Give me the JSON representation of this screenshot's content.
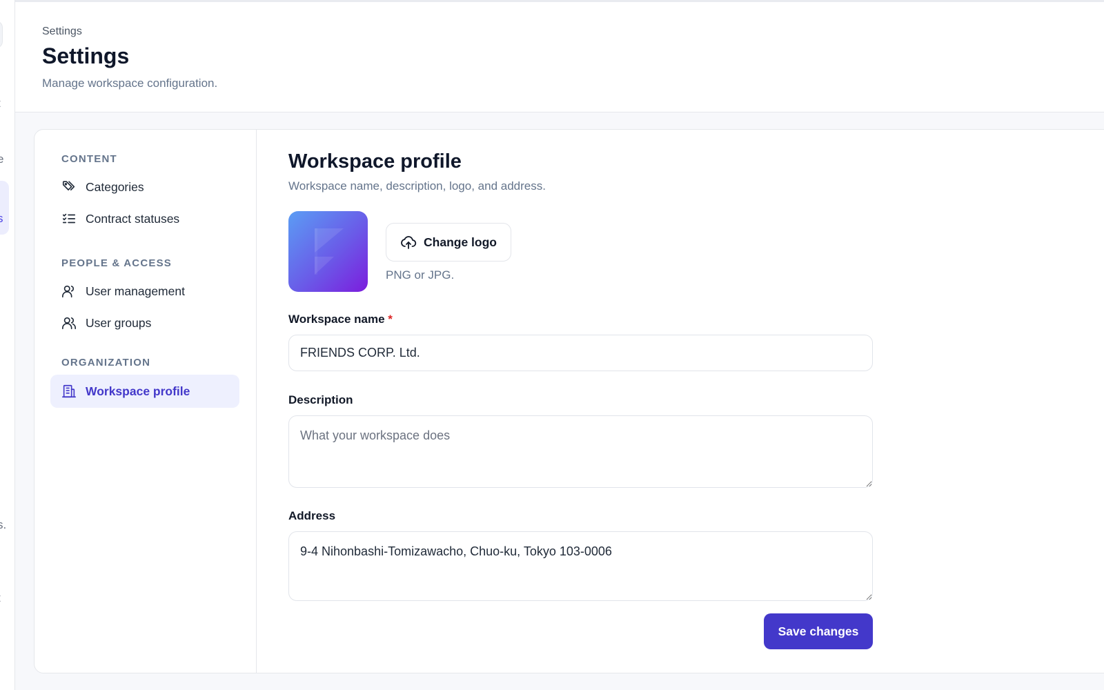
{
  "rail": {
    "fragments": [
      "t",
      "e",
      "s",
      "s.",
      "t"
    ]
  },
  "header": {
    "breadcrumb": "Settings",
    "title": "Settings",
    "subtitle": "Manage workspace configuration."
  },
  "subnav": {
    "sections": [
      {
        "label": "CONTENT",
        "items": [
          {
            "label": "Categories",
            "icon": "tags-icon"
          },
          {
            "label": "Contract statuses",
            "icon": "list-checks-icon"
          }
        ]
      },
      {
        "label": "PEOPLE & ACCESS",
        "items": [
          {
            "label": "User management",
            "icon": "user-icon"
          },
          {
            "label": "User groups",
            "icon": "users-icon"
          }
        ]
      },
      {
        "label": "ORGANIZATION",
        "items": [
          {
            "label": "Workspace profile",
            "icon": "building-icon",
            "active": true
          }
        ]
      }
    ]
  },
  "content": {
    "title": "Workspace profile",
    "subtitle": "Workspace name, description, logo, and address.",
    "logo": {
      "change_button": "Change logo",
      "button_icon": "cloud-upload-icon",
      "hint": "PNG or JPG."
    },
    "fields": {
      "workspace_name": {
        "label": "Workspace name",
        "required_mark": "*",
        "value": "FRIENDS CORP. Ltd."
      },
      "description": {
        "label": "Description",
        "value": "",
        "placeholder": "What your workspace does"
      },
      "address": {
        "label": "Address",
        "value": "9-4 Nihonbashi-Tomizawacho, Chuo-ku, Tokyo 103-0006"
      }
    },
    "save_button": "Save changes"
  },
  "colors": {
    "accent": "#4338ca",
    "active_bg": "#eef0fe",
    "required": "#dc2626",
    "logo_gradient": [
      "#5b9df4",
      "#6a5be8",
      "#7c1ddd"
    ]
  }
}
